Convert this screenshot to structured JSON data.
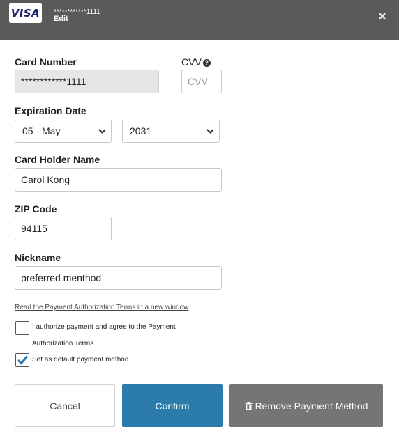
{
  "header": {
    "card_brand": "VISA",
    "masked_number": "************1111",
    "mode_label": "Edit",
    "close_glyph": "×",
    "bg_color": "#5a5a5a"
  },
  "form": {
    "card_number": {
      "label": "Card Number",
      "value": "************1111"
    },
    "cvv": {
      "label": "CVV",
      "placeholder": "CVV",
      "help_icon": "question-circle-icon"
    },
    "expiration": {
      "label": "Expiration Date",
      "month": "05 - May",
      "year": "2031"
    },
    "holder_name": {
      "label": "Card Holder Name",
      "value": "Carol Kong"
    },
    "zip": {
      "label": "ZIP Code",
      "value": "94115"
    },
    "nickname": {
      "label": "Nickname",
      "value": "preferred menthod"
    }
  },
  "terms_link": "Read the Payment Authorization Terms in a new window",
  "checks": {
    "authorize": {
      "line1": "I authorize payment and agree to the Payment",
      "line2": "Authorization Terms",
      "checked": false
    },
    "default": {
      "label": "Set as default payment method",
      "checked": true
    }
  },
  "buttons": {
    "cancel": "Cancel",
    "confirm": "Confirm",
    "remove": "Remove Payment Method",
    "remove_icon": "trash-icon"
  },
  "colors": {
    "accent": "#2b7bab",
    "remove_bg": "#757575",
    "check_color": "#2b7bab"
  }
}
